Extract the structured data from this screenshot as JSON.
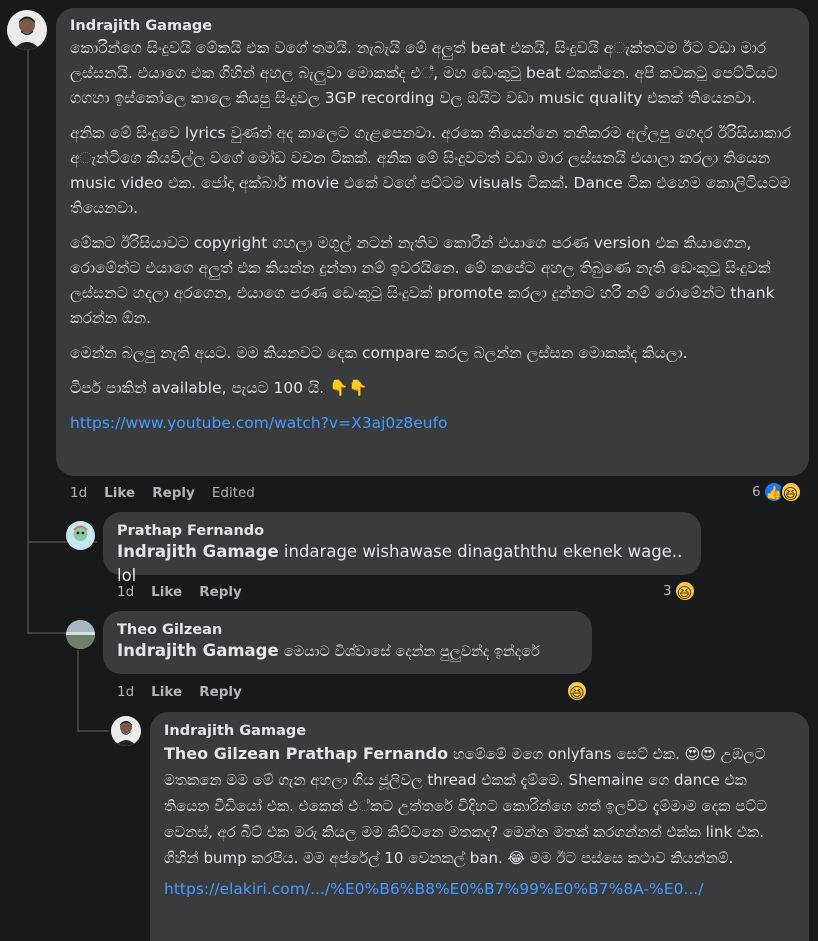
{
  "comments": {
    "main": {
      "author": "Indrajith Gamage",
      "paragraphs": [
        "කොරින්ගෙ සිංදුවයි මේකයි එක වගේ තමයි. නැබැයි මේ අලුත් beat එකයි, සිංදුවයි අැක්තටම ඊට වඩා මාර ලස්සනයි. එයාගෙ එක ගිහින් අහල බැලුවා මොකක්ද එ්, මහ ඩෙංකුටු beat එකක්නෙ. අපි කවකටු පෙට්ටියට ගගහා ඉස්කෝලෙ කාලෙ කියපු සිංදුවල 3GP recording වල ඔයිට වඩා music quality එකක් තියෙනවා.",
        "අනික මේ සිංදුවෙ lyrics වුණත් අද කාලෙට ගැළපෙනවා. අරකෙ තියෙන්නෙ තනිකරම අල්ලපු ගෙදර ඊරිසියාකාර අැන්ටිගෙ කියවිල්ල වගේ මෝඩ වචන ටිකක්. අනික මේ සිංදුවටත් වඩා මාර ලස්සනයි එයාලා කරලා තියෙන music video එක. ජෝදා අක්බාර් movie එකේ වගේ පට්ටම visuals ටිකක්. Dance ටික එහෙම කොලිටියටම තියෙනවා.",
        "මේකට ඊරිසියාවට copyright ගහලා මගුල් නටන් නැතිව කොරින් එයාගෙ පරණ version එක කියාගෙන, රොමේන්ට එයාගෙ අලුත් එක කියන්න දුන්නා නම් ඉවරයිනෙ. මේ කපේට අහල තිබුණෙ නැති ඩෙංකුටු සිංදුවක් ලස්සනට හදලා අරගෙන, එයාගෙ පරණ ඩෙංකුටු සිංදුවක් promote කරලා දුන්නට හරි නම් රොමේන්ට thank කරන්න ඕන.",
        "මෙන්න බලපු නැති අයට. මම කියනවට දෙක compare කරල බලන්න ලස්සන මොකක්ද කියලා.",
        "ටිපර් පාකින් available, පැයට 100 යි. 👇👇"
      ],
      "link": "https://www.youtube.com/watch?v=X3aj0z8eufo",
      "time": "1d",
      "like": "Like",
      "reply": "Reply",
      "edited": "Edited",
      "reaction_count": "6"
    },
    "reply1": {
      "author": "Prathap Fernando",
      "mention": "Indrajith Gamage",
      "text": "indarage wishawase dinagaththu ekenek wage.. lol",
      "time": "1d",
      "like": "Like",
      "reply": "Reply",
      "reaction_count": "3"
    },
    "reply2": {
      "author": "Theo Gilzean",
      "mention": "Indrajith Gamage",
      "text": "මෙයාට විශ්වාසේ දෙන්න පුලුවන්ද ඉන්දරේ",
      "time": "1d",
      "like": "Like",
      "reply": "Reply"
    },
    "reply3": {
      "author": "Indrajith Gamage",
      "mention": "Theo Gilzean Prathap Fernando",
      "paragraph": "හමේමේ මගෙ onlyfans සෙට් එක. 😍😍 උඹලට මතකනෙ මම මේ ගැන අහලා ගිය ජූලිවල thread එකක් දැම්මෙ. Shemaine ගෙ dance එක තියෙන වීඩියෝ එක. එකෙන් එ්කට උත්තරේ විදිහට කොරින්ගෙ හත් ඉලව්ව දැම්මාම දෙක පට්ට වෙනස්, අර බීට් එක මරු කියල මම කිව්වනෙ මතකද? මෙන්න මතක් කරගන්නත් එක්ක link එක. ගිහින් bump කරපිය. මම අප්රේල් 10 වෙනකල් ban. 😂 මම ඊට පස්සෙ කථාව කියන්නම්.",
      "link": "https://elakiri.com/.../%E0%B6%B8%E0%B7%99%E0%B7%8A-%E0.../"
    }
  },
  "colors": {
    "background": "#18191a",
    "bubble": "#3a3b3c",
    "link": "#4599ff",
    "muted": "#b0b3b8"
  }
}
